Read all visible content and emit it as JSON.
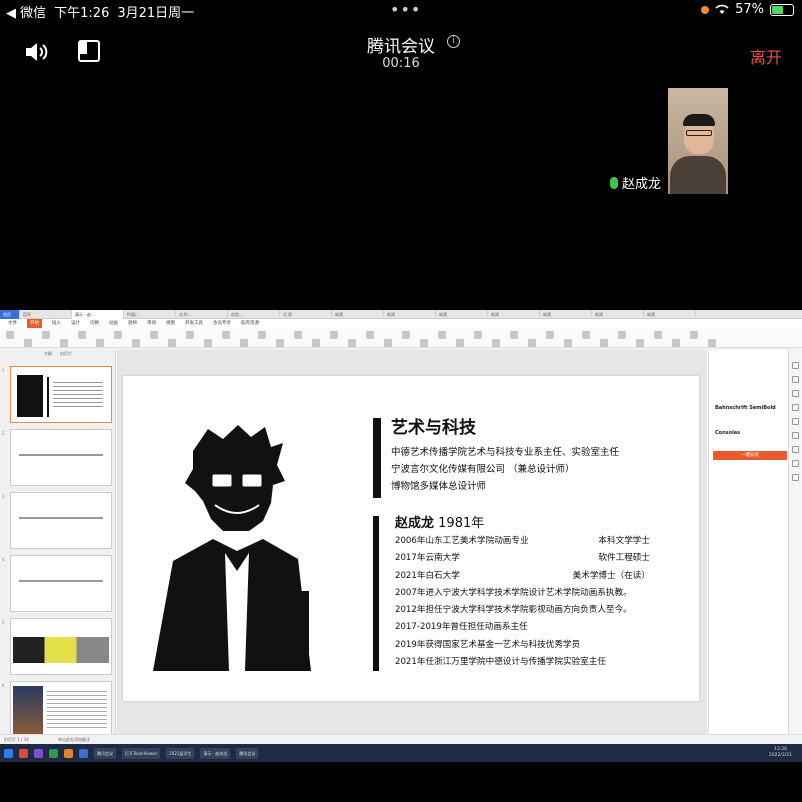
{
  "status_bar": {
    "back_app": "◀ 微信",
    "time": "下午1:26",
    "date": "3月21日周一",
    "battery": "57%",
    "battery_level": 0.57,
    "accent_orange": "#f28b30"
  },
  "meeting": {
    "title": "腾讯会议",
    "duration": "00:16",
    "leave_label": "离开",
    "leave_color": "#e8523f",
    "icons": [
      "speaker-icon",
      "layout-icon",
      "info-icon",
      "more-icon"
    ]
  },
  "participant": {
    "name": "赵成龙",
    "mic_color": "#3fc54a"
  },
  "shared_screen": {
    "tabs": [
      "首页",
      "稻壳",
      "演示 - 赵...",
      "怀疑/...",
      "艺术/...",
      "创造...",
      "记 影",
      "新建",
      "新建",
      "新建",
      "新建",
      "新建",
      "新建",
      "新建"
    ],
    "menus": [
      "文件",
      "开始",
      "插入",
      "设计",
      "切换",
      "动画",
      "放映",
      "审阅",
      "视图",
      "开发工具",
      "会员专享",
      "稻壳资源"
    ],
    "thumb_tabs": [
      "大纲",
      "幻灯片"
    ],
    "thumb_numbers": [
      "1",
      "2",
      "3",
      "4",
      "5",
      "6"
    ],
    "slide": {
      "title": "艺术与科技",
      "roles": [
        "中德艺术传播学院艺术与科技专业系主任、实验室主任",
        "宁波言尔文化传媒有限公司 （兼总设计师）",
        "博物馆多媒体总设计师"
      ],
      "name": "赵成龙",
      "birth": "1981年",
      "bio": [
        {
          "left": "2006年山东工艺美术学院动画专业",
          "right": "本科文学学士"
        },
        {
          "left": "2017年云南大学",
          "right": "软件工程硕士"
        },
        {
          "left": "2021年白石大学",
          "right": "美术学博士（在读）"
        },
        {
          "left": "2007年进入宁波大学科学技术学院设计艺术学院动画系执教。",
          "right": ""
        },
        {
          "left": "2012年担任宁波大学科学技术学院影视动画方向负责人至今。",
          "right": ""
        },
        {
          "left": "2017-2019年曾任担任动画系主任",
          "right": ""
        },
        {
          "left": "2019年获得国家艺术基金一艺术与科技优秀学员",
          "right": ""
        },
        {
          "left": "2021年任浙江万里学院中德设计与传播学院实验室主任",
          "right": ""
        }
      ]
    },
    "right_pane": {
      "fonts": [
        "Bahnschrift SemiBold",
        "Consolas"
      ],
      "button": "一键安装"
    },
    "status_text": "幻灯片 1 / 34",
    "notes_hint": "单击此处添加备注",
    "taskbar_apps": [
      "腾讯会议",
      "打开TeamViewer",
      "2021届学生",
      "演示 - 赵成龙",
      "腾讯会议"
    ],
    "clock_time": "13:26",
    "clock_date": "2022/3/21",
    "brand_orange": "#e95b2b"
  }
}
